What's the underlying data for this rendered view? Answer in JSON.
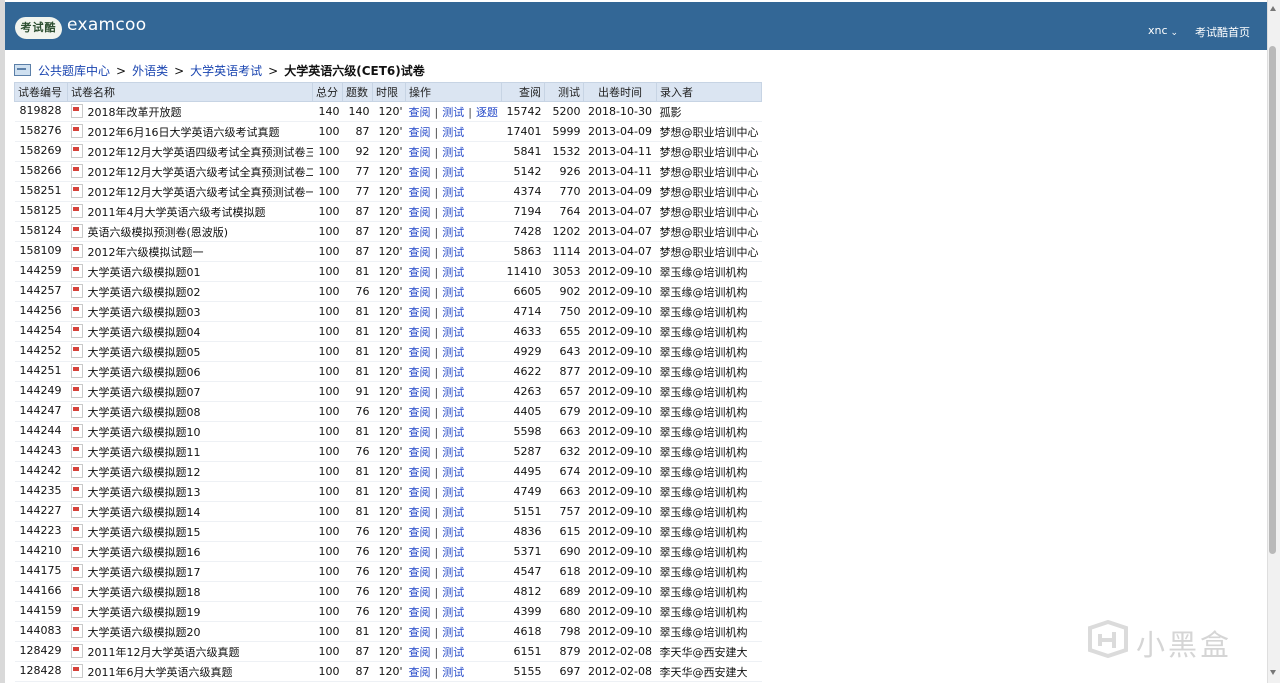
{
  "header": {
    "logo_badge": "考试酷",
    "logo_text": "examcoo",
    "user": "xnc",
    "home_link": "考试酷首页"
  },
  "breadcrumb": {
    "items": [
      "公共题库中心",
      "外语类",
      "大学英语考试"
    ],
    "separator": ">",
    "current": "大学英语六级(CET6)试卷"
  },
  "table": {
    "headers": {
      "id": "试卷编号",
      "name": "试卷名称",
      "total": "总分",
      "count": "题数",
      "limit": "时限",
      "ops": "操作",
      "views": "查阅",
      "tests": "测试",
      "date": "出卷时间",
      "author": "录入者"
    },
    "op_labels": {
      "view": "查阅",
      "test": "测试",
      "step": "逐题"
    },
    "rows": [
      {
        "id": "819828",
        "name": "2018年改革开放题",
        "total": "140",
        "count": "140",
        "limit": "120'",
        "views": "15742",
        "tests": "5200",
        "date": "2018-10-30",
        "author": "孤影",
        "step": true
      },
      {
        "id": "158276",
        "name": "2012年6月16日大学英语六级考试真题",
        "total": "100",
        "count": "87",
        "limit": "120'",
        "views": "17401",
        "tests": "5999",
        "date": "2013-04-09",
        "author": "梦想@职业培训中心"
      },
      {
        "id": "158269",
        "name": "2012年12月大学英语四级考试全真预测试卷三",
        "total": "100",
        "count": "92",
        "limit": "120'",
        "views": "5841",
        "tests": "1532",
        "date": "2013-04-11",
        "author": "梦想@职业培训中心"
      },
      {
        "id": "158266",
        "name": "2012年12月大学英语六级考试全真预测试卷二",
        "total": "100",
        "count": "77",
        "limit": "120'",
        "views": "5142",
        "tests": "926",
        "date": "2013-04-11",
        "author": "梦想@职业培训中心"
      },
      {
        "id": "158251",
        "name": "2012年12月大学英语六级考试全真预测试卷一",
        "total": "100",
        "count": "77",
        "limit": "120'",
        "views": "4374",
        "tests": "770",
        "date": "2013-04-09",
        "author": "梦想@职业培训中心"
      },
      {
        "id": "158125",
        "name": "2011年4月大学英语六级考试模拟题",
        "total": "100",
        "count": "87",
        "limit": "120'",
        "views": "7194",
        "tests": "764",
        "date": "2013-04-07",
        "author": "梦想@职业培训中心"
      },
      {
        "id": "158124",
        "name": "英语六级模拟预测卷(恩波版)",
        "total": "100",
        "count": "87",
        "limit": "120'",
        "views": "7428",
        "tests": "1202",
        "date": "2013-04-07",
        "author": "梦想@职业培训中心"
      },
      {
        "id": "158109",
        "name": "2012年六级模拟试题一",
        "total": "100",
        "count": "87",
        "limit": "120'",
        "views": "5863",
        "tests": "1114",
        "date": "2013-04-07",
        "author": "梦想@职业培训中心"
      },
      {
        "id": "144259",
        "name": "大学英语六级模拟题01",
        "total": "100",
        "count": "81",
        "limit": "120'",
        "views": "11410",
        "tests": "3053",
        "date": "2012-09-10",
        "author": "翠玉缘@培训机构"
      },
      {
        "id": "144257",
        "name": "大学英语六级模拟题02",
        "total": "100",
        "count": "76",
        "limit": "120'",
        "views": "6605",
        "tests": "902",
        "date": "2012-09-10",
        "author": "翠玉缘@培训机构"
      },
      {
        "id": "144256",
        "name": "大学英语六级模拟题03",
        "total": "100",
        "count": "81",
        "limit": "120'",
        "views": "4714",
        "tests": "750",
        "date": "2012-09-10",
        "author": "翠玉缘@培训机构"
      },
      {
        "id": "144254",
        "name": "大学英语六级模拟题04",
        "total": "100",
        "count": "81",
        "limit": "120'",
        "views": "4633",
        "tests": "655",
        "date": "2012-09-10",
        "author": "翠玉缘@培训机构"
      },
      {
        "id": "144252",
        "name": "大学英语六级模拟题05",
        "total": "100",
        "count": "81",
        "limit": "120'",
        "views": "4929",
        "tests": "643",
        "date": "2012-09-10",
        "author": "翠玉缘@培训机构"
      },
      {
        "id": "144251",
        "name": "大学英语六级模拟题06",
        "total": "100",
        "count": "81",
        "limit": "120'",
        "views": "4622",
        "tests": "877",
        "date": "2012-09-10",
        "author": "翠玉缘@培训机构"
      },
      {
        "id": "144249",
        "name": "大学英语六级模拟题07",
        "total": "100",
        "count": "91",
        "limit": "120'",
        "views": "4263",
        "tests": "657",
        "date": "2012-09-10",
        "author": "翠玉缘@培训机构"
      },
      {
        "id": "144247",
        "name": "大学英语六级模拟题08",
        "total": "100",
        "count": "76",
        "limit": "120'",
        "views": "4405",
        "tests": "679",
        "date": "2012-09-10",
        "author": "翠玉缘@培训机构"
      },
      {
        "id": "144244",
        "name": "大学英语六级模拟题10",
        "total": "100",
        "count": "81",
        "limit": "120'",
        "views": "5598",
        "tests": "663",
        "date": "2012-09-10",
        "author": "翠玉缘@培训机构"
      },
      {
        "id": "144243",
        "name": "大学英语六级模拟题11",
        "total": "100",
        "count": "76",
        "limit": "120'",
        "views": "5287",
        "tests": "632",
        "date": "2012-09-10",
        "author": "翠玉缘@培训机构"
      },
      {
        "id": "144242",
        "name": "大学英语六级模拟题12",
        "total": "100",
        "count": "81",
        "limit": "120'",
        "views": "4495",
        "tests": "674",
        "date": "2012-09-10",
        "author": "翠玉缘@培训机构"
      },
      {
        "id": "144235",
        "name": "大学英语六级模拟题13",
        "total": "100",
        "count": "81",
        "limit": "120'",
        "views": "4749",
        "tests": "663",
        "date": "2012-09-10",
        "author": "翠玉缘@培训机构"
      },
      {
        "id": "144227",
        "name": "大学英语六级模拟题14",
        "total": "100",
        "count": "81",
        "limit": "120'",
        "views": "5151",
        "tests": "757",
        "date": "2012-09-10",
        "author": "翠玉缘@培训机构"
      },
      {
        "id": "144223",
        "name": "大学英语六级模拟题15",
        "total": "100",
        "count": "76",
        "limit": "120'",
        "views": "4836",
        "tests": "615",
        "date": "2012-09-10",
        "author": "翠玉缘@培训机构"
      },
      {
        "id": "144210",
        "name": "大学英语六级模拟题16",
        "total": "100",
        "count": "76",
        "limit": "120'",
        "views": "5371",
        "tests": "690",
        "date": "2012-09-10",
        "author": "翠玉缘@培训机构"
      },
      {
        "id": "144175",
        "name": "大学英语六级模拟题17",
        "total": "100",
        "count": "76",
        "limit": "120'",
        "views": "4547",
        "tests": "618",
        "date": "2012-09-10",
        "author": "翠玉缘@培训机构"
      },
      {
        "id": "144166",
        "name": "大学英语六级模拟题18",
        "total": "100",
        "count": "76",
        "limit": "120'",
        "views": "4812",
        "tests": "689",
        "date": "2012-09-10",
        "author": "翠玉缘@培训机构"
      },
      {
        "id": "144159",
        "name": "大学英语六级模拟题19",
        "total": "100",
        "count": "76",
        "limit": "120'",
        "views": "4399",
        "tests": "680",
        "date": "2012-09-10",
        "author": "翠玉缘@培训机构"
      },
      {
        "id": "144083",
        "name": "大学英语六级模拟题20",
        "total": "100",
        "count": "81",
        "limit": "120'",
        "views": "4618",
        "tests": "798",
        "date": "2012-09-10",
        "author": "翠玉缘@培训机构"
      },
      {
        "id": "128429",
        "name": "2011年12月大学英语六级真题",
        "total": "100",
        "count": "87",
        "limit": "120'",
        "views": "6151",
        "tests": "879",
        "date": "2012-02-08",
        "author": "李天华@西安建大"
      },
      {
        "id": "128428",
        "name": "2011年6月大学英语六级真题",
        "total": "100",
        "count": "87",
        "limit": "120'",
        "views": "5155",
        "tests": "697",
        "date": "2012-02-08",
        "author": "李天华@西安建大"
      }
    ]
  },
  "watermark": {
    "text": "小黑盒"
  },
  "colors": {
    "header_bg": "#336796",
    "link": "#2247c8",
    "table_header_bg": "#dbe5f2"
  }
}
